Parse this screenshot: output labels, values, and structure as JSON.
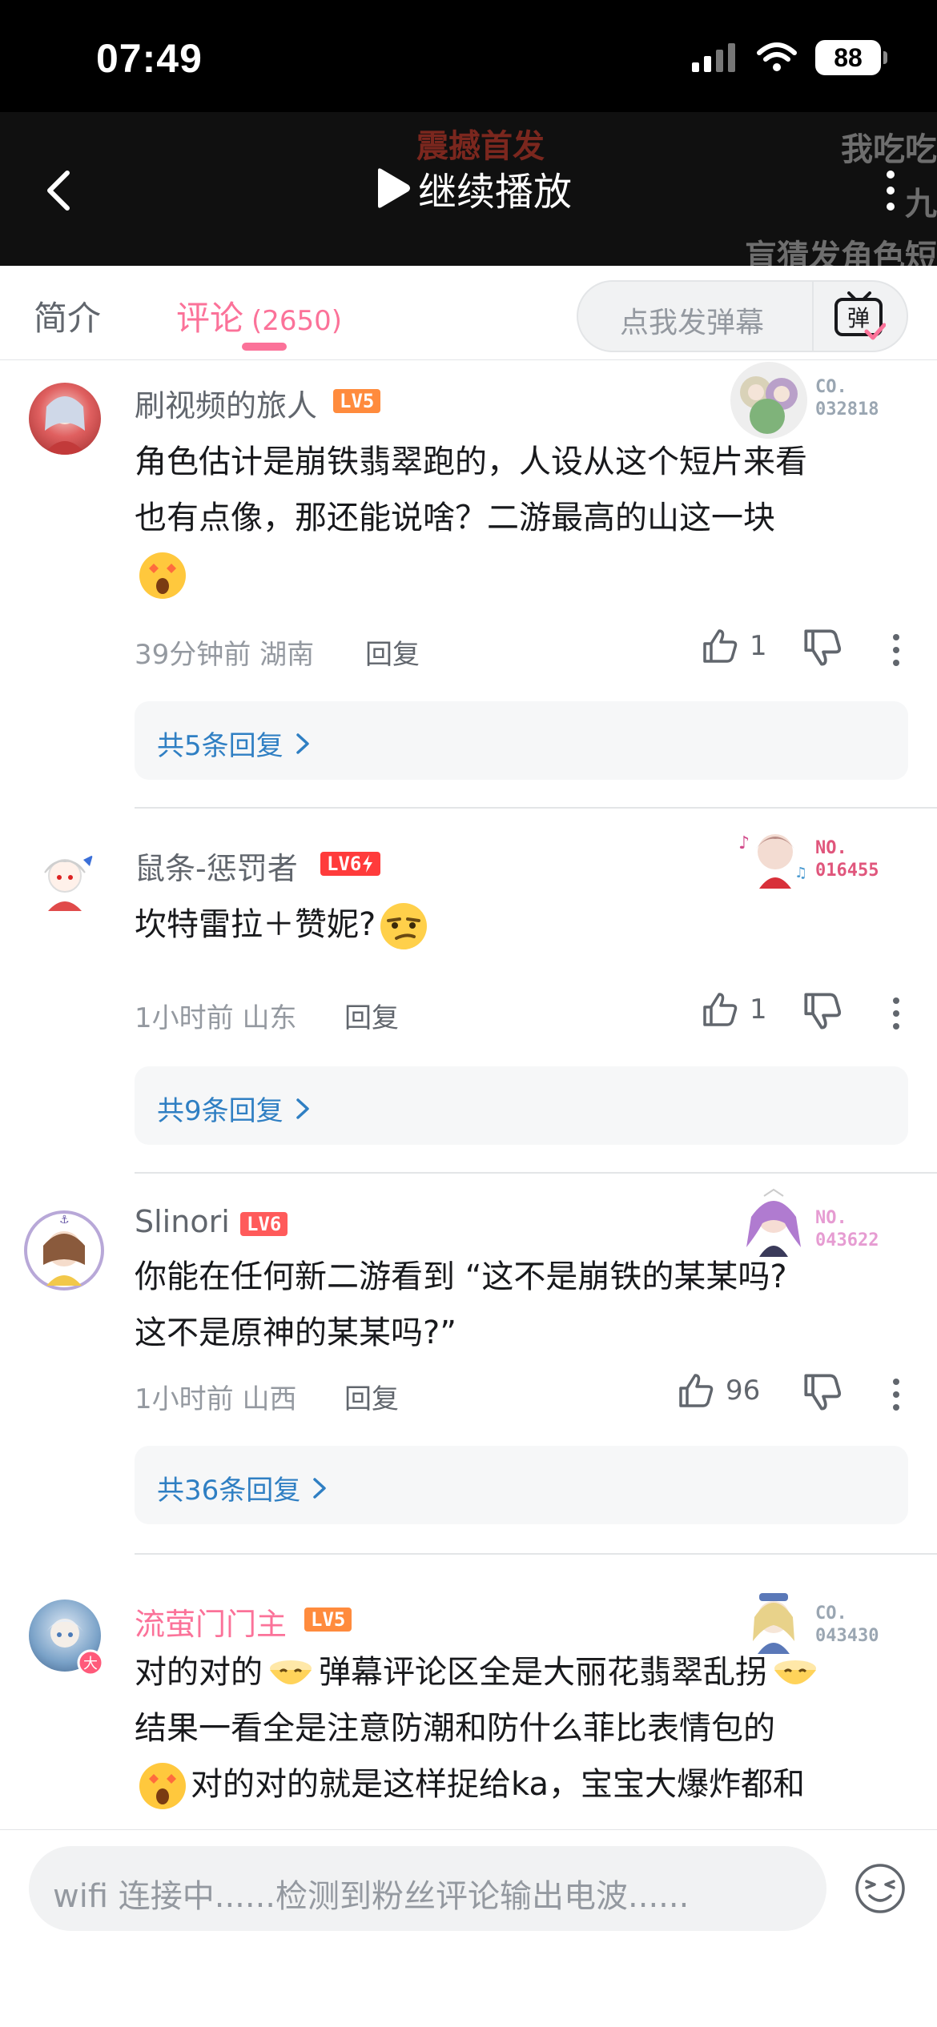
{
  "status_bar": {
    "time": "07:49",
    "battery": "88"
  },
  "header": {
    "continue_label": "继续播放",
    "bg_danmaku": [
      "震撼首发",
      "我吃吃",
      "九",
      "盲猜发角色短"
    ]
  },
  "tabs": {
    "intro": "简介",
    "comments": "评论",
    "comment_count": "(2650)",
    "danmaku_placeholder": "点我发弹幕",
    "danmaku_icon_label": "弹"
  },
  "comments": [
    {
      "username": "刷视频的旅人",
      "level": "LV5",
      "badge_line1": "CO.",
      "badge_line2": "032818",
      "text_lines": [
        "角色估计是崩铁翡翠跑的，人设从这个短片来看",
        "也有点像，那还能说啥？二游最高的山这一块"
      ],
      "time": "39分钟前",
      "location": "湖南",
      "reply_label": "回复",
      "likes": "1",
      "replies_label": "共5条回复"
    },
    {
      "username": "鼠条-惩罚者",
      "level": "LV6",
      "badge_line1": "NO.",
      "badge_line2": "016455",
      "text": "坎特雷拉＋赞妮?",
      "time": "1小时前",
      "location": "山东",
      "reply_label": "回复",
      "likes": "1",
      "replies_label": "共9条回复"
    },
    {
      "username": "Slinori",
      "level": "LV6",
      "badge_line1": "NO.",
      "badge_line2": "043622",
      "text_lines": [
        "你能在任何新二游看到 “这不是崩铁的某某吗?",
        "这不是原神的某某吗?”"
      ],
      "time": "1小时前",
      "location": "山西",
      "reply_label": "回复",
      "likes": "96",
      "replies_label": "共36条回复"
    },
    {
      "username": "流萤门门主",
      "level": "LV5",
      "badge_line1": "CO.",
      "badge_line2": "043430",
      "text_line1_a": "对的对的",
      "text_line1_b": "弹幕评论区全是大丽花翡翠乱拐",
      "text_line2": "结果一看全是注意防潮和防什么菲比表情包的",
      "text_line3": "对的对的就是这样捉给ka，宝宝大爆炸都和"
    }
  ],
  "bottom": {
    "input_placeholder": "wifi 连接中......检测到粉丝评论输出电波......"
  }
}
